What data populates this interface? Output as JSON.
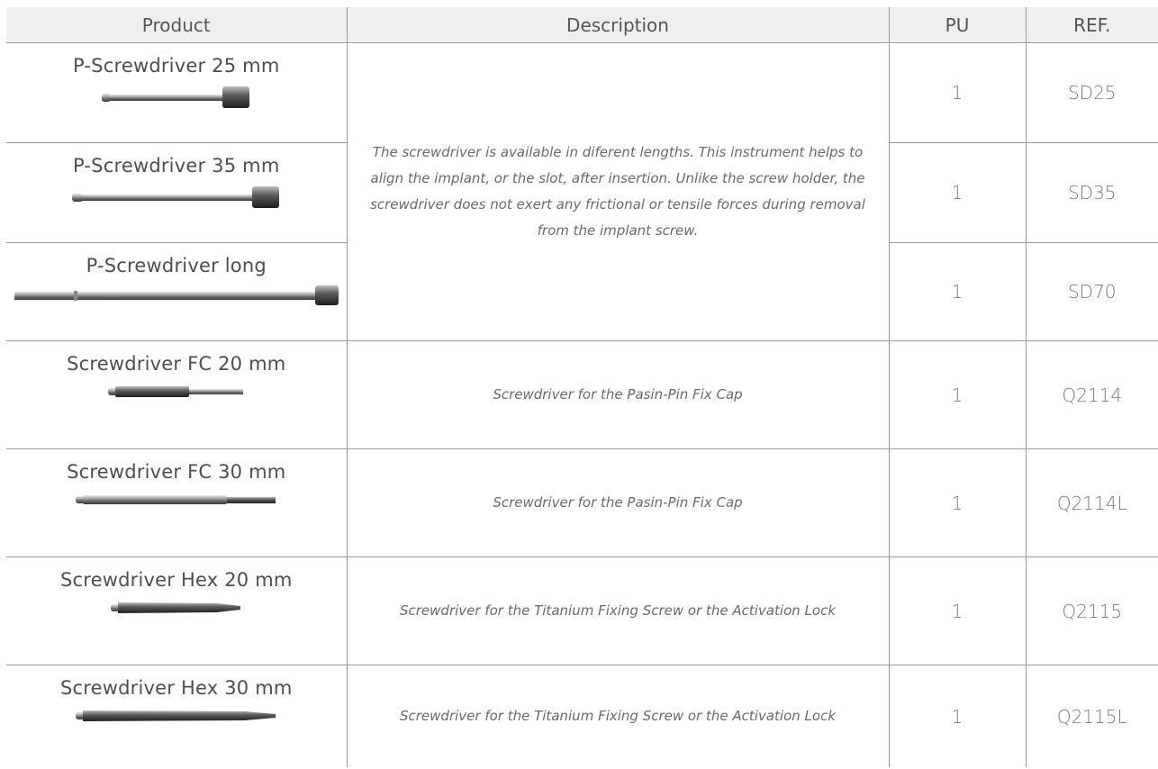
{
  "table": {
    "headers": {
      "product": "Product",
      "description": "Description",
      "pu": "PU",
      "ref": "REF."
    },
    "shared_description": "The screwdriver is available in diferent lengths. This instrument helps to align the implant, or the slot, after insertion. Unlike the screw holder, the screwdriver does not exert any frictional or tensile forces during removal from the implant screw.",
    "rows": [
      {
        "product": "P-Screwdriver 25 mm",
        "pu": "1",
        "ref": "SD25",
        "image": "screwdriver-25-image"
      },
      {
        "product": "P-Screwdriver 35 mm",
        "pu": "1",
        "ref": "SD35",
        "image": "screwdriver-35-image"
      },
      {
        "product": "P-Screwdriver long",
        "pu": "1",
        "ref": "SD70",
        "image": "screwdriver-long-image"
      },
      {
        "product": "Screwdriver FC 20 mm",
        "description": "Screwdriver for the Pasin-Pin Fix Cap",
        "pu": "1",
        "ref": "Q2114",
        "image": "screwdriver-fc20-image"
      },
      {
        "product": "Screwdriver FC 30 mm",
        "description": "Screwdriver for the Pasin-Pin Fix Cap",
        "pu": "1",
        "ref": "Q2114L",
        "image": "screwdriver-fc30-image"
      },
      {
        "product": "Screwdriver Hex 20 mm",
        "description": "Screwdriver for the Titanium Fixing Screw or the Activation Lock",
        "pu": "1",
        "ref": "Q2115",
        "image": "screwdriver-hex20-image"
      },
      {
        "product": "Screwdriver Hex 30 mm",
        "description": "Screwdriver for the Titanium Fixing Screw or the Activation Lock",
        "pu": "1",
        "ref": "Q2115L",
        "image": "screwdriver-hex30-image"
      }
    ]
  }
}
